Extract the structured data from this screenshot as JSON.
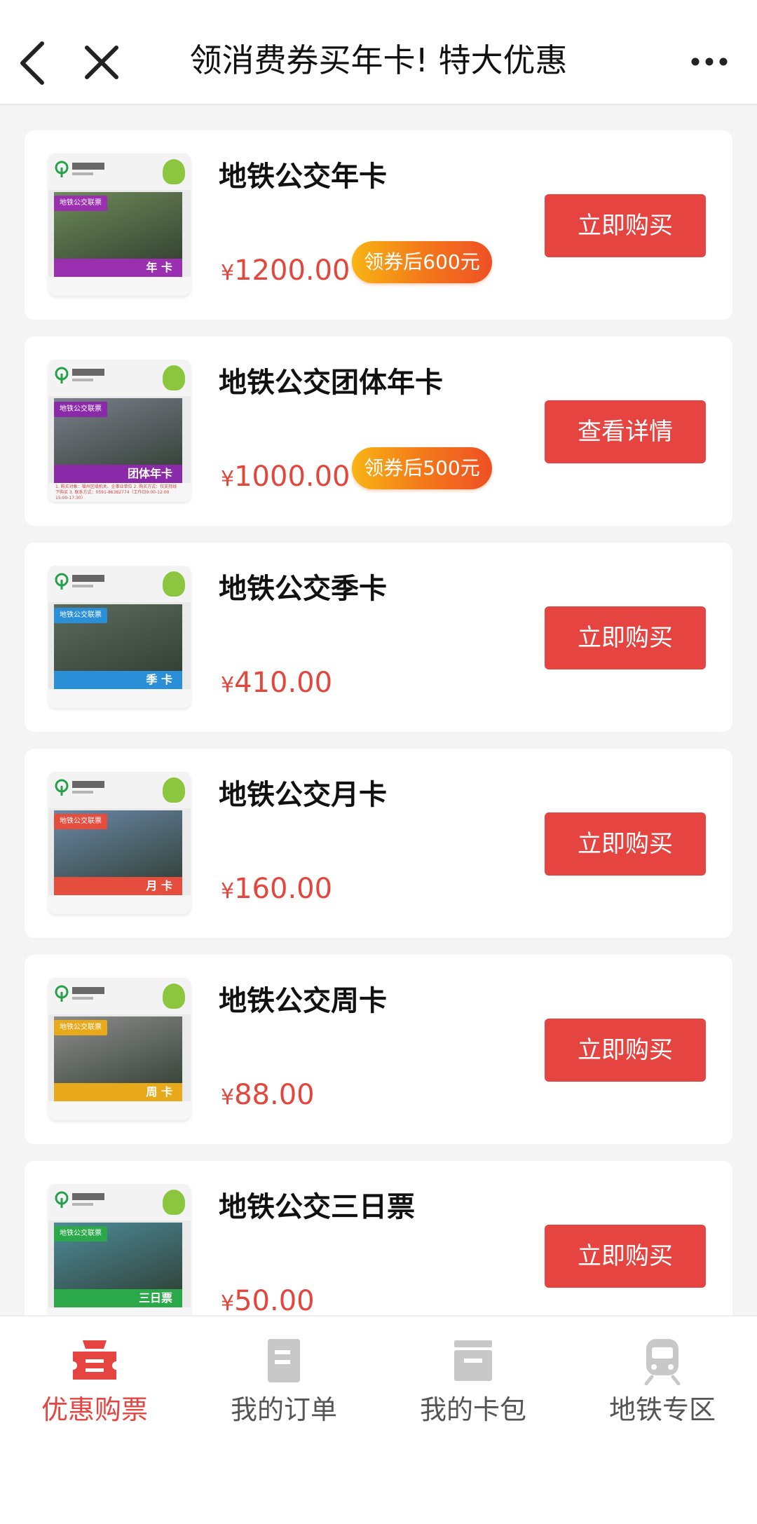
{
  "header": {
    "title": "领消费券买年卡! 特大优惠",
    "back_icon": "chevron-left-icon",
    "close_icon": "close-icon",
    "more_icon": "more-dots-icon"
  },
  "colors": {
    "accent": "#e64440",
    "price": "#e3463c",
    "coupon_start": "#f8b414",
    "coupon_end": "#ee5024",
    "tab_inactive": "#555555"
  },
  "products": [
    {
      "name": "地铁公交年卡",
      "price_symbol": "¥",
      "price": "1200.00",
      "coupon": "领券后600元",
      "button": "立即购买",
      "thumb": {
        "logo": "福州地铁",
        "tag": "地铁公交联票",
        "band_label": "年 卡",
        "color": "#9a2fb0",
        "photo": "#6e8a58",
        "notes": ""
      }
    },
    {
      "name": "地铁公交团体年卡",
      "price_symbol": "¥",
      "price": "1000.00",
      "coupon": "领券后500元",
      "button": "查看详情",
      "thumb": {
        "logo": "福州地铁",
        "tag": "地铁公交联票",
        "band_label": "团体年卡",
        "color": "#8b2aa8",
        "photo": "#7b7f8c",
        "notes": "1. 购买对象：福州区域机关、企事业单位 2. 购买方式：仅支持线下购买 3. 联系方式：0591-86382774（工作日9:00-12:00 15:00-17:30）"
      }
    },
    {
      "name": "地铁公交季卡",
      "price_symbol": "¥",
      "price": "410.00",
      "coupon": "",
      "button": "立即购买",
      "thumb": {
        "logo": "福州地铁",
        "tag": "地铁公交联票",
        "band_label": "季 卡",
        "color": "#2b8fd8",
        "photo": "#5d6b5e",
        "notes": ""
      }
    },
    {
      "name": "地铁公交月卡",
      "price_symbol": "¥",
      "price": "160.00",
      "coupon": "",
      "button": "立即购买",
      "thumb": {
        "logo": "福州地铁",
        "tag": "地铁公交联票",
        "band_label": "月 卡",
        "color": "#e54d3f",
        "photo": "#6a87a6",
        "notes": ""
      }
    },
    {
      "name": "地铁公交周卡",
      "price_symbol": "¥",
      "price": "88.00",
      "coupon": "",
      "button": "立即购买",
      "thumb": {
        "logo": "福州地铁",
        "tag": "地铁公交联票",
        "band_label": "周 卡",
        "color": "#e8a91a",
        "photo": "#8d8d8d",
        "notes": ""
      }
    },
    {
      "name": "地铁公交三日票",
      "price_symbol": "¥",
      "price": "50.00",
      "coupon": "",
      "button": "立即购买",
      "thumb": {
        "logo": "福州地铁",
        "tag": "地铁公交联票",
        "band_label": "三日票",
        "color": "#2aa84a",
        "photo": "#4d8b9a",
        "notes": ""
      }
    }
  ],
  "tabs": [
    {
      "label": "优惠购票",
      "icon": "ticket-icon",
      "active": true
    },
    {
      "label": "我的订单",
      "icon": "order-document-icon",
      "active": false
    },
    {
      "label": "我的卡包",
      "icon": "card-wallet-icon",
      "active": false
    },
    {
      "label": "地铁专区",
      "icon": "metro-train-icon",
      "active": false
    }
  ]
}
